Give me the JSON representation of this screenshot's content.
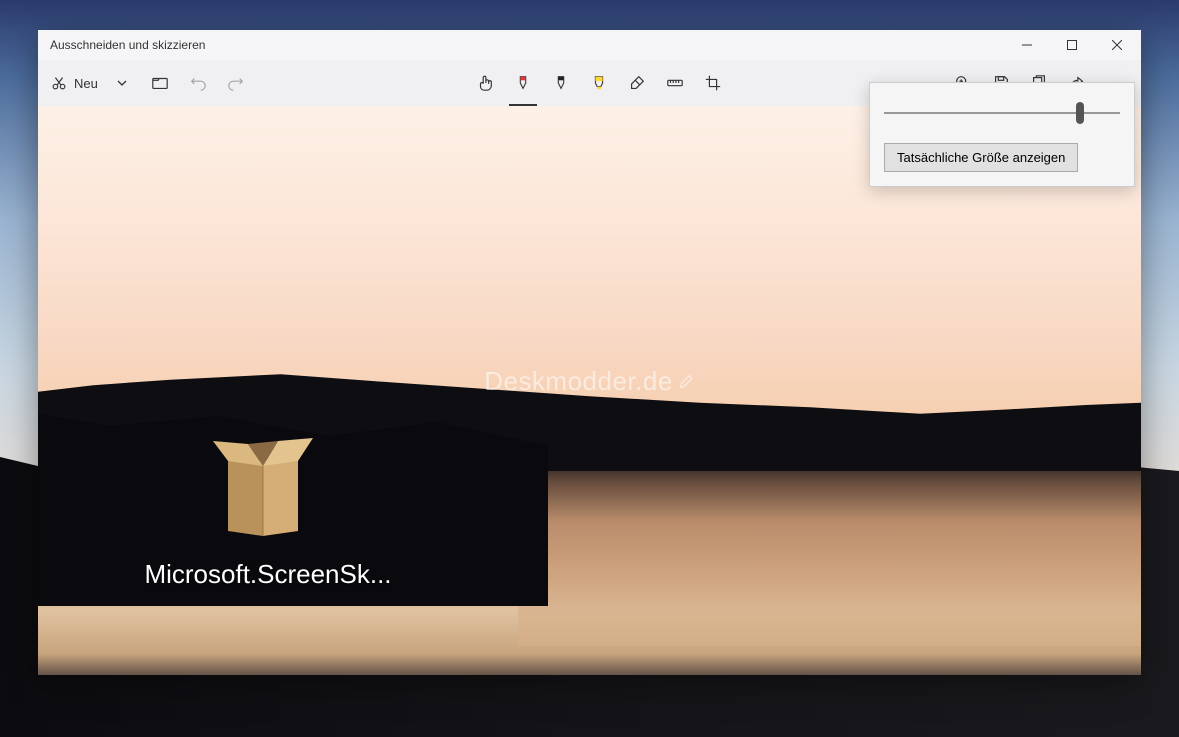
{
  "window": {
    "title": "Ausschneiden und skizzieren"
  },
  "toolbar": {
    "new_label": "Neu"
  },
  "zoom_panel": {
    "actual_size_label": "Tatsächliche Größe anzeigen",
    "slider_value": 83
  },
  "canvas": {
    "watermark": "Deskmodder.de",
    "desktop_icon_label": "Microsoft.ScreenSk..."
  }
}
